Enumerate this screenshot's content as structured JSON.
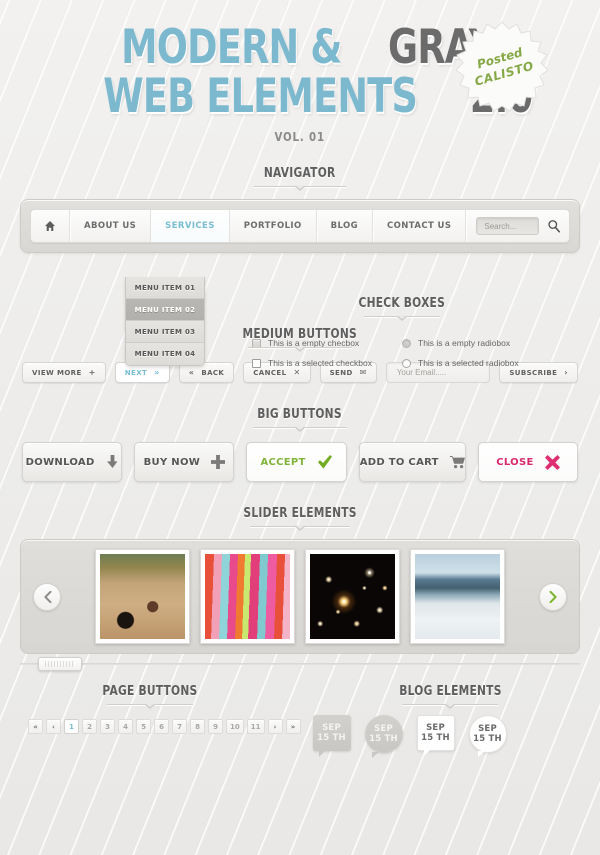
{
  "header": {
    "title_part1": "MODERN &",
    "title_part2": "GRAY",
    "title_part3": "WEB ELEMENTS",
    "title_part4": "2.0",
    "volume": "VOL. 01",
    "badge_line1": "Posted",
    "badge_line2": "CALISTO"
  },
  "sections": {
    "navigator": "NAVIGATOR",
    "check_boxes": "CHECK BOXES",
    "medium_buttons": "MEDIUM BUTTONS",
    "big_buttons": "BIG BUTTONS",
    "slider_elements": "SLIDER ELEMENTS",
    "page_buttons": "PAGE BUTTONS",
    "blog_elements": "BLOG ELEMENTS"
  },
  "navbar": {
    "items": [
      {
        "label": "",
        "icon": "home-icon",
        "active": false
      },
      {
        "label": "ABOUT US",
        "active": false
      },
      {
        "label": "SERVICES",
        "active": true
      },
      {
        "label": "PORTFOLIO",
        "active": false
      },
      {
        "label": "BLOG",
        "active": false
      },
      {
        "label": "CONTACT US",
        "active": false
      }
    ],
    "search_placeholder": "Search...",
    "search_value": ""
  },
  "dropdown": {
    "items": [
      {
        "label": "MENU ITEM 01",
        "active": false
      },
      {
        "label": "MENU ITEM 02",
        "active": true
      },
      {
        "label": "MENU ITEM 03",
        "active": false
      },
      {
        "label": "MENU ITEM 04",
        "active": false
      }
    ]
  },
  "checkboxes": [
    {
      "label": "This is a empty checbox",
      "type": "checkbox",
      "checked": false
    },
    {
      "label": "This is a empty radiobox",
      "type": "radio",
      "checked": false
    },
    {
      "label": "This is a selected checkbox",
      "type": "checkbox",
      "checked": true
    },
    {
      "label": "This is a selected radiobox",
      "type": "radio",
      "checked": true
    }
  ],
  "medium_buttons": [
    {
      "label": "VIEW MORE",
      "icon": "+",
      "accent": false
    },
    {
      "label": "NEXT",
      "icon": "»",
      "accent": true
    },
    {
      "label": "BACK",
      "icon": "«",
      "accent": false,
      "icon_first": true
    },
    {
      "label": "CANCEL",
      "icon": "✕",
      "accent": false
    },
    {
      "label": "SEND",
      "icon": "✉",
      "accent": false
    }
  ],
  "email_form": {
    "placeholder": "Your Email.....",
    "value": "",
    "subscribe_label": "SUBSCRIBE",
    "subscribe_icon": "›"
  },
  "big_buttons": [
    {
      "label": "DOWNLOAD",
      "icon": "download-icon",
      "style": "gray"
    },
    {
      "label": "BUY NOW",
      "icon": "plus-icon",
      "style": "gray"
    },
    {
      "label": "ACCEPT",
      "icon": "check-icon",
      "style": "green"
    },
    {
      "label": "ADD TO CART",
      "icon": "cart-icon",
      "style": "gray"
    },
    {
      "label": "CLOSE",
      "icon": "cross-icon",
      "style": "pink"
    }
  ],
  "slider": {
    "prev_icon": "chevron-left-icon",
    "next_icon": "chevron-right-icon",
    "thumbs": [
      {
        "alt": "motocross-bike-photo"
      },
      {
        "alt": "colorful-fabrics-photo"
      },
      {
        "alt": "galaxy-stars-photo"
      },
      {
        "alt": "snowy-lake-photo"
      }
    ]
  },
  "pager": {
    "first": "«",
    "prev": "‹",
    "pages": [
      "1",
      "2",
      "3",
      "4",
      "5",
      "6",
      "7",
      "8",
      "9",
      "10",
      "11"
    ],
    "active_page": "1",
    "next": "›",
    "last": "»"
  },
  "blog_elements": [
    {
      "month": "SEP",
      "day": "15 TH",
      "shape": "square",
      "fill": "gray"
    },
    {
      "month": "SEP",
      "day": "15 TH",
      "shape": "circle",
      "fill": "gray"
    },
    {
      "month": "SEP",
      "day": "15 TH",
      "shape": "square",
      "fill": "white"
    },
    {
      "month": "SEP",
      "day": "15 TH",
      "shape": "circle",
      "fill": "white"
    }
  ],
  "colors": {
    "accent_blue": "#79bdd2",
    "accent_green": "#80b43a",
    "accent_pink": "#d8296b",
    "gray_text": "#6b6b6b",
    "background": "#f0efed"
  }
}
